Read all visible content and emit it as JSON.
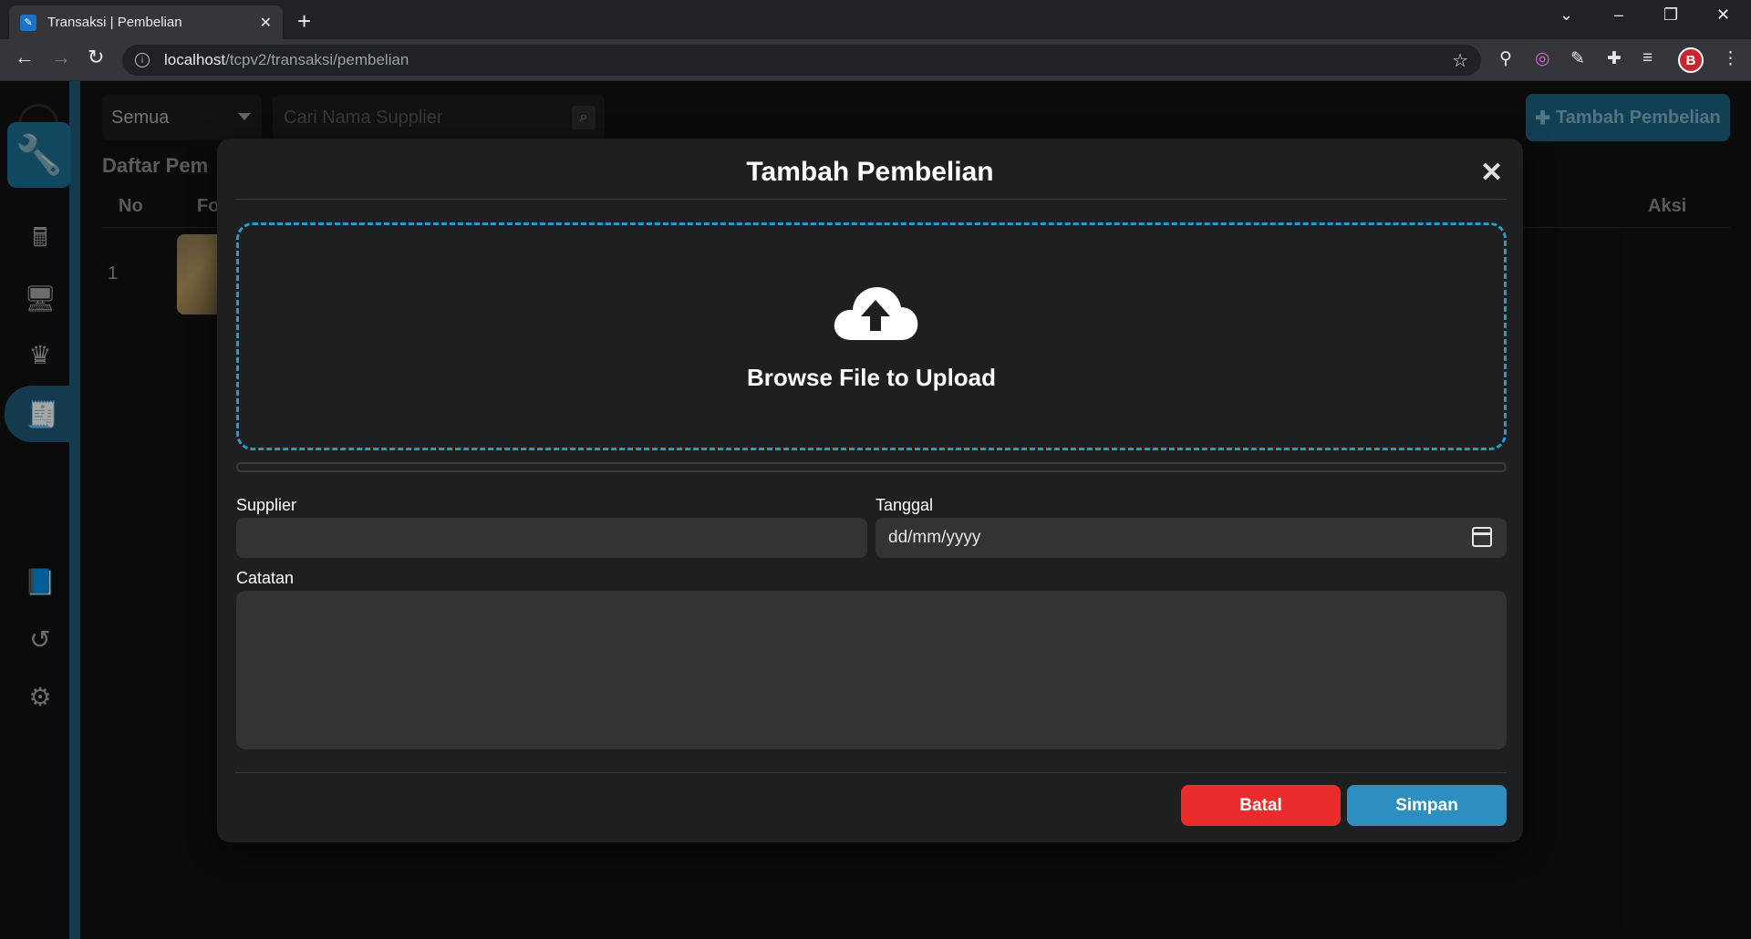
{
  "browser": {
    "tab_title": "Transaksi | Pembelian",
    "url_host": "localhost",
    "url_path": "/tcpv2/transaksi/pembelian",
    "profile_initial": "B"
  },
  "page": {
    "filter_selected": "Semua",
    "search_placeholder": "Cari Nama Supplier",
    "add_button_label": "Tambah Pembelian",
    "list_title": "Daftar Pem",
    "columns": [
      "No",
      "Fo",
      "Aksi"
    ],
    "rows": [
      {
        "no": "1"
      }
    ]
  },
  "modal": {
    "title": "Tambah Pembelian",
    "upload_label": "Browse File to Upload",
    "upload_progress": 0,
    "supplier_label": "Supplier",
    "supplier_value": "",
    "date_label": "Tanggal",
    "date_placeholder": "dd/mm/yyyy",
    "notes_label": "Catatan",
    "notes_value": "",
    "cancel_label": "Batal",
    "save_label": "Simpan"
  },
  "colors": {
    "accent": "#2a9ac6",
    "cancel": "#ea2c2c",
    "save": "#2d8fc0",
    "sidebar_active": "#1f5b77"
  },
  "icons": {
    "sidebar": [
      "wrench-logo-icon",
      "cash-register-icon",
      "monitor-icon",
      "crown-icon",
      "invoice-icon",
      "book-icon",
      "history-icon",
      "gear-icon"
    ]
  }
}
